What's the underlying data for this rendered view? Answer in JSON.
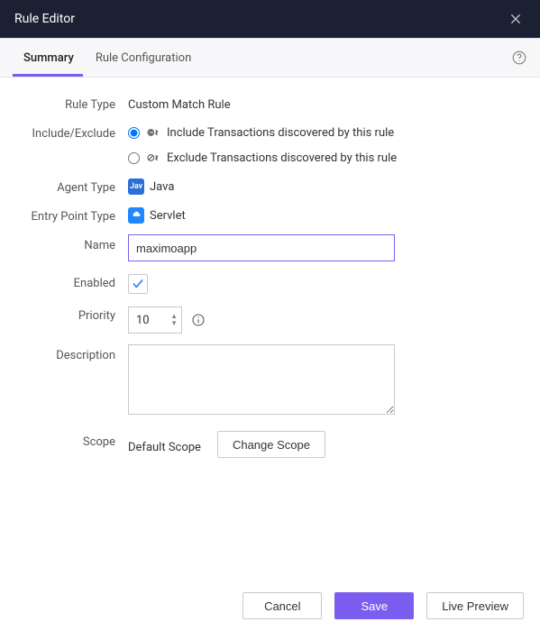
{
  "title": "Rule Editor",
  "tabs": {
    "summary": "Summary",
    "ruleConfig": "Rule Configuration"
  },
  "labels": {
    "ruleType": "Rule Type",
    "includeExclude": "Include/Exclude",
    "agentType": "Agent Type",
    "entryPointType": "Entry Point Type",
    "name": "Name",
    "enabled": "Enabled",
    "priority": "Priority",
    "description": "Description",
    "scope": "Scope"
  },
  "values": {
    "ruleType": "Custom Match Rule",
    "includeText": "Include Transactions discovered by this rule",
    "excludeText": "Exclude Transactions discovered by this rule",
    "includeSelected": true,
    "agentBadge": "Jav",
    "agentType": "Java",
    "entryPointType": "Servlet",
    "name": "maximoapp",
    "enabled": true,
    "priority": "10",
    "description": "",
    "scope": "Default Scope"
  },
  "buttons": {
    "changeScope": "Change Scope",
    "cancel": "Cancel",
    "save": "Save",
    "livePreview": "Live Preview"
  }
}
